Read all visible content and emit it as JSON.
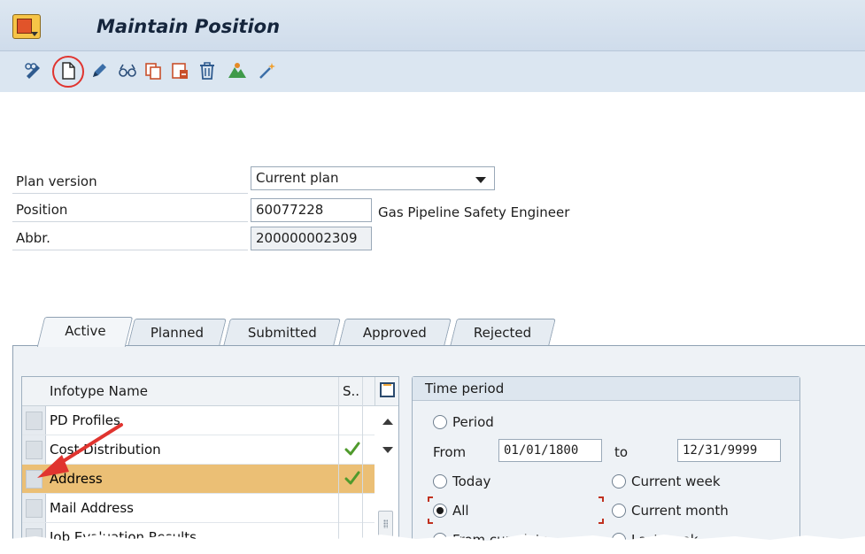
{
  "window": {
    "title": "Maintain Position"
  },
  "toolbar": {
    "icons": [
      "display-icon",
      "create-icon",
      "change-icon",
      "overview-icon",
      "copy-icon",
      "delimit-icon",
      "delete-icon",
      "structure-icon",
      "wizard-icon"
    ]
  },
  "form": {
    "plan_version": {
      "label": "Plan version",
      "value": "Current plan"
    },
    "position": {
      "label": "Position",
      "value": "60077228",
      "text": "Gas Pipeline Safety Engineer"
    },
    "abbr": {
      "label": "Abbr.",
      "value": "200000002309"
    }
  },
  "tabs": [
    {
      "label": "Active",
      "active": true
    },
    {
      "label": "Planned"
    },
    {
      "label": "Submitted"
    },
    {
      "label": "Approved"
    },
    {
      "label": "Rejected"
    }
  ],
  "infotypes": {
    "header_name": "Infotype Name",
    "header_status": "S..",
    "rows": [
      {
        "name": "PD Profiles",
        "status": ""
      },
      {
        "name": "Cost Distribution",
        "status": "check"
      },
      {
        "name": "Address",
        "status": "check",
        "highlighted": true
      },
      {
        "name": "Mail Address",
        "status": ""
      },
      {
        "name": "Job Evaluation Results",
        "status": ""
      }
    ]
  },
  "time_period": {
    "title": "Time period",
    "period": "Period",
    "from_label": "From",
    "from": "01/01/1800",
    "to_label": "to",
    "to": "12/31/9999",
    "today": "Today",
    "current_week": "Current week",
    "all": "All",
    "current_month": "Current month",
    "from_curr_date": "From curr.date",
    "last_week": "Last week",
    "selected": "All"
  },
  "colors": {
    "title_bar": "#dde7f1",
    "highlight_row": "#ebbf75",
    "annotation": "#e0342f"
  }
}
